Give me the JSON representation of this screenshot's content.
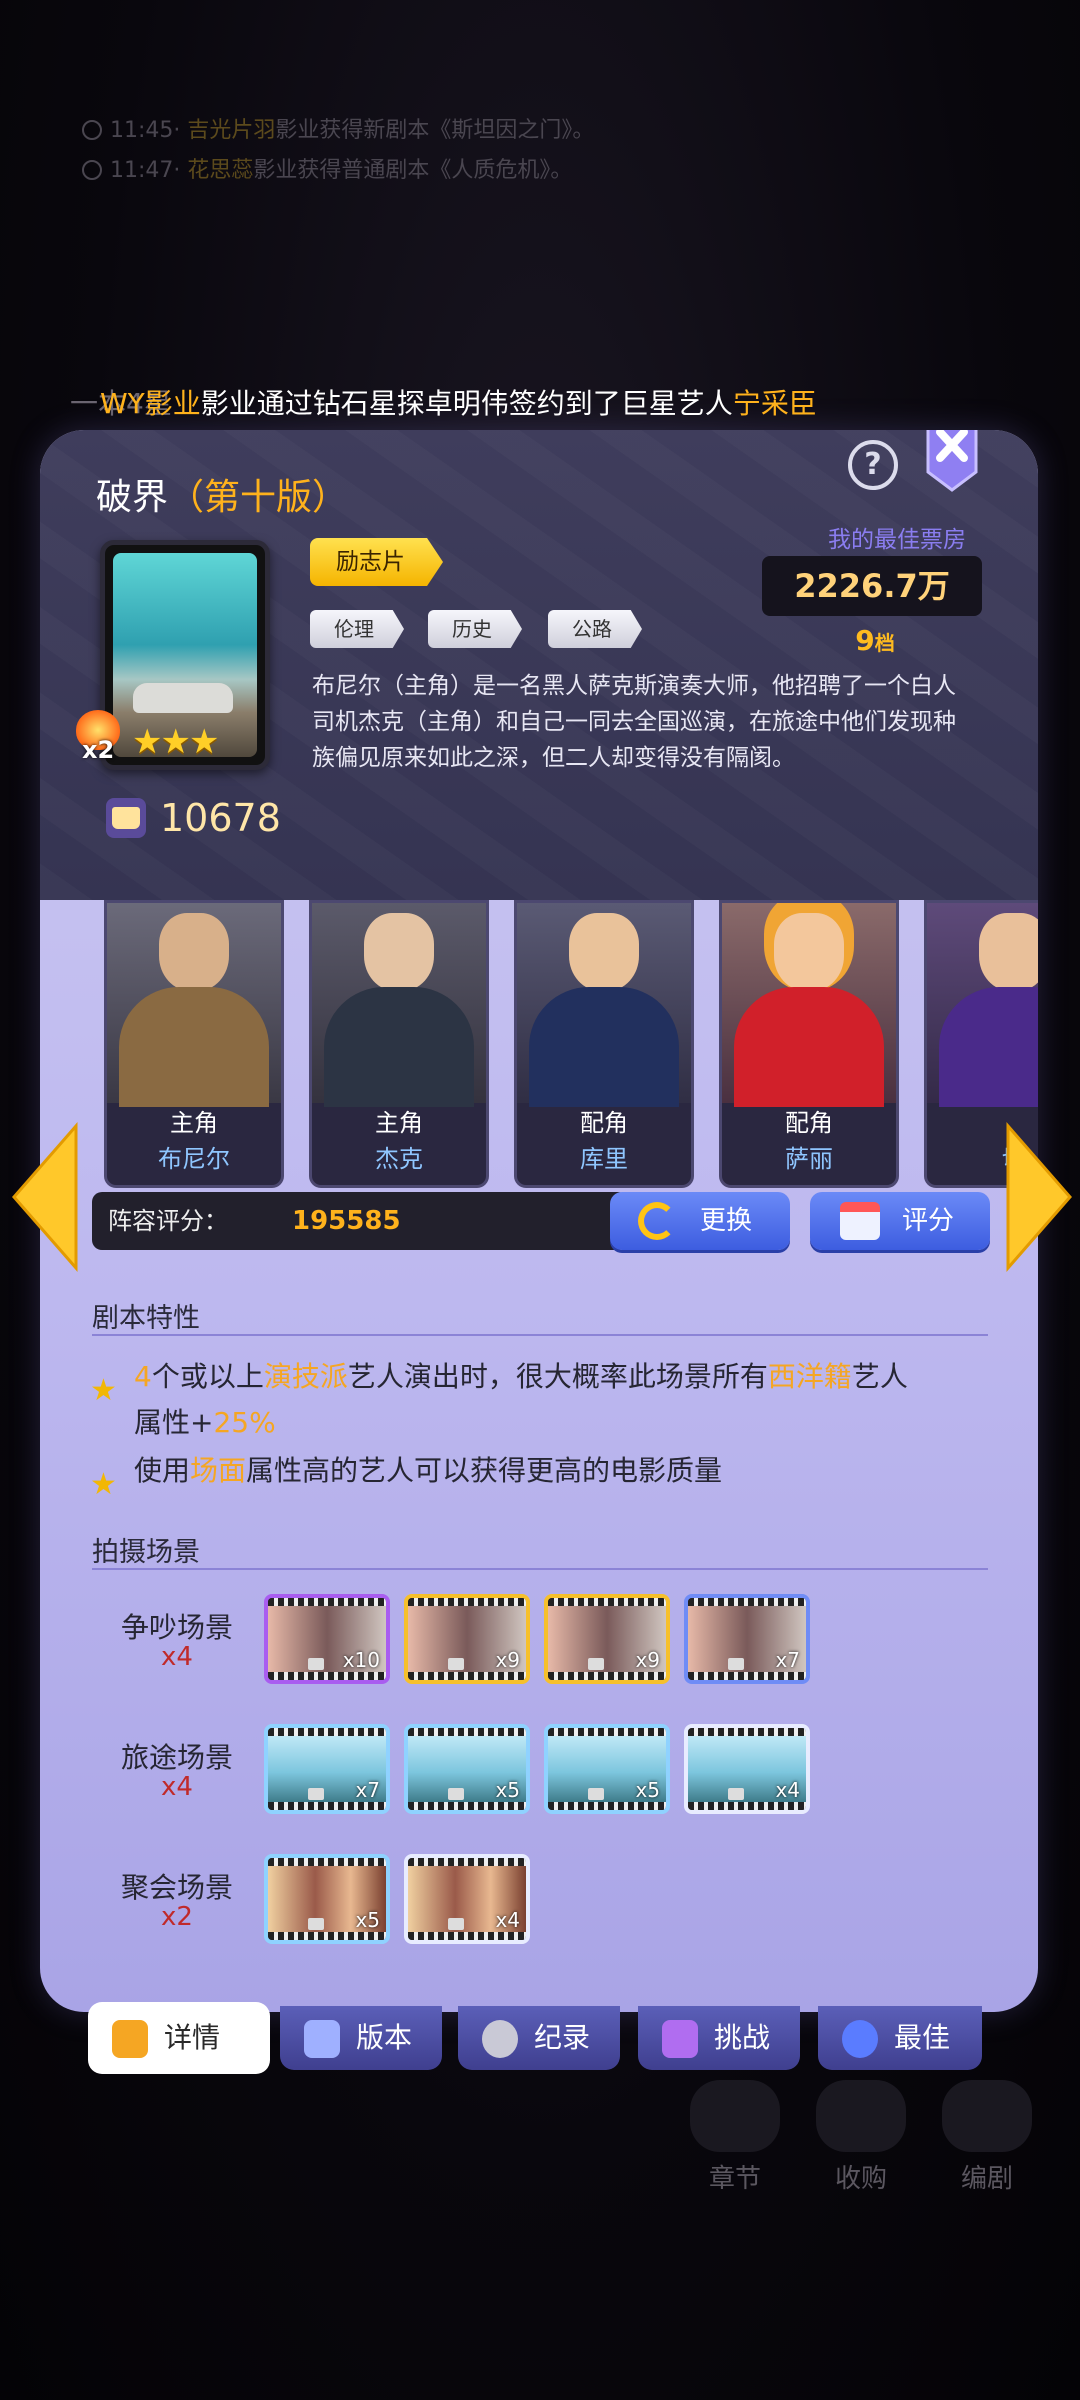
{
  "log": [
    {
      "time": "11:45",
      "pre": "· ",
      "name": "吉光片羽",
      "text": "影业获得新剧本《斯坦因之门》。"
    },
    {
      "time": "11:47",
      "pre": "· ",
      "name": "花思蕊",
      "text": "影业获得普通剧本《人质危机》。"
    }
  ],
  "ticker": {
    "prefix": "一本4星",
    "company": "WY影业",
    "mid": "影业通过钻石星探卓明伟签约到了巨星艺人",
    "artist": "宁采臣"
  },
  "film": {
    "title": "破界",
    "version": "（第十版）",
    "stars": "★★★",
    "badge": "x2",
    "read_count": "10678",
    "genre": "励志片",
    "tags": [
      "伦理",
      "历史",
      "公路"
    ],
    "best_box_label": "我的最佳票房",
    "best_box_value": "2226.7万",
    "best_rank_num": "9",
    "best_rank_unit": "档",
    "synopsis": "布尼尔（主角）是一名黑人萨克斯演奏大师，他招聘了一个白人司机杰克（主角）和自己一同去全国巡演，在旅途中他们发现种族偏见原来如此之深，但二人却变得没有隔阂。"
  },
  "cast": [
    {
      "role": "主角",
      "name": "布尼尔"
    },
    {
      "role": "主角",
      "name": "杰克"
    },
    {
      "role": "配角",
      "name": "库里"
    },
    {
      "role": "配角",
      "name": "萨丽"
    },
    {
      "role": "",
      "name": "切"
    }
  ],
  "score": {
    "label": "阵容评分：",
    "value": "195585",
    "swap_label": "更换",
    "rate_label": "评分"
  },
  "features": {
    "title": "剧本特性",
    "f1_a": "4",
    "f1_b": "个或以上",
    "f1_c": "演技派",
    "f1_d": "艺人演出时，很大概率此场景所有",
    "f1_e": "西洋籍",
    "f1_f": "艺人",
    "f1_g": "属性+",
    "f1_h": "25%",
    "f2_a": "使用",
    "f2_b": "场面",
    "f2_c": "属性高的艺人可以获得更高的电影质量"
  },
  "scenes": {
    "title": "拍摄场景",
    "rows": [
      {
        "name": "争吵场景",
        "count": "x4",
        "tiles": [
          "x10",
          "x9",
          "x9",
          "x7"
        ]
      },
      {
        "name": "旅途场景",
        "count": "x4",
        "tiles": [
          "x7",
          "x5",
          "x5",
          "x4"
        ]
      },
      {
        "name": "聚会场景",
        "count": "x2",
        "tiles": [
          "x5",
          "x4"
        ]
      }
    ]
  },
  "tabs": [
    "详情",
    "版本",
    "纪录",
    "挑战",
    "最佳"
  ],
  "bg_bottom": [
    "章节",
    "收购",
    "编剧"
  ],
  "colors": {
    "accent_gold": "#ffb21c",
    "panel_top": "#3f3d5c",
    "panel_body": "#c4c0f0",
    "tab_blue": "#4f51a6"
  }
}
